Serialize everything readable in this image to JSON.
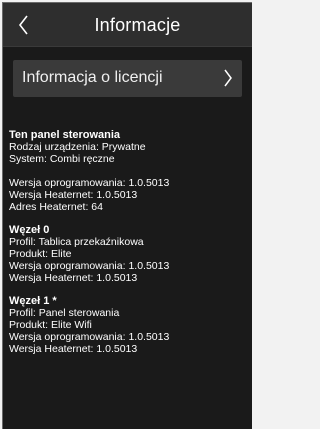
{
  "header": {
    "title": "Informacje"
  },
  "license": {
    "label": "Informacja o licencji"
  },
  "panel": {
    "heading": "Ten panel sterowania",
    "device_type": "Rodzaj urządzenia: Prywatne",
    "system": "System: Combi ręczne",
    "firmware": "Wersja oprogramowania: 1.0.5013",
    "heaternet": "Wersja Heaternet: 1.0.5013",
    "address": "Adres Heaternet: 64"
  },
  "nodes": [
    {
      "heading": "Węzeł 0",
      "profile": "Profil: Tablica przekaźnikowa",
      "product": "Produkt: Elite",
      "firmware": "Wersja oprogramowania: 1.0.5013",
      "heaternet": "Wersja Heaternet: 1.0.5013"
    },
    {
      "heading": "Węzeł 1 *",
      "profile": "Profil: Panel sterowania",
      "product": "Produkt: Elite Wifi",
      "firmware": "Wersja oprogramowania: 1.0.5013",
      "heaternet": "Wersja Heaternet: 1.0.5013"
    }
  ],
  "icons": {
    "back": "chevron-left-icon",
    "forward": "chevron-right-icon"
  },
  "colors": {
    "background": "#1a1a1a",
    "header": "#2e2e2e",
    "button": "#3a3a3a",
    "text": "#ffffff"
  }
}
